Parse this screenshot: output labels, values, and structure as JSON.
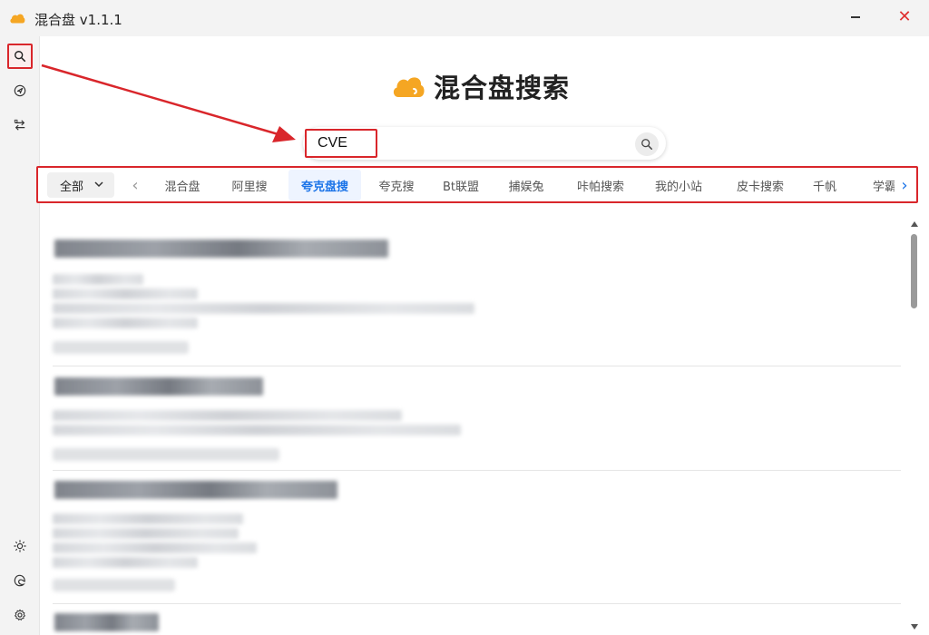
{
  "window": {
    "title": "混合盘 v1.1.1",
    "close_glyph": "✕"
  },
  "brand": {
    "title": "混合盘搜索",
    "accent_color": "#f5a623"
  },
  "search": {
    "value": "CVE",
    "placeholder": ""
  },
  "filters": {
    "dropdown_label": "全部",
    "prev_glyph": "‹",
    "next_glyph": "›",
    "tabs": [
      {
        "label": "混合盘",
        "active": false
      },
      {
        "label": "阿里搜",
        "active": false
      },
      {
        "label": "夸克盘搜",
        "active": true
      },
      {
        "label": "夸克搜",
        "active": false
      },
      {
        "label": "Bt联盟",
        "active": false
      },
      {
        "label": "捕娱兔",
        "active": false
      },
      {
        "label": "咔帕搜索",
        "active": false
      },
      {
        "label": "我的小站",
        "active": false
      },
      {
        "label": "皮卡搜索",
        "active": false
      },
      {
        "label": "千帆",
        "active": false
      },
      {
        "label": "学霸",
        "active": false
      }
    ]
  },
  "sidebar": {
    "items": [
      {
        "name": "search",
        "icon": "search-icon",
        "active": true
      },
      {
        "name": "send",
        "icon": "send-icon",
        "active": false
      },
      {
        "name": "transfer",
        "icon": "transfer-icon",
        "active": false
      },
      {
        "name": "theme",
        "icon": "sun-icon",
        "active": false
      },
      {
        "name": "edge",
        "icon": "edge-icon",
        "active": false
      },
      {
        "name": "settings",
        "icon": "gear-icon",
        "active": false
      }
    ]
  },
  "colors": {
    "highlight_red": "#d9262b",
    "active_blue": "#1a73e8"
  }
}
